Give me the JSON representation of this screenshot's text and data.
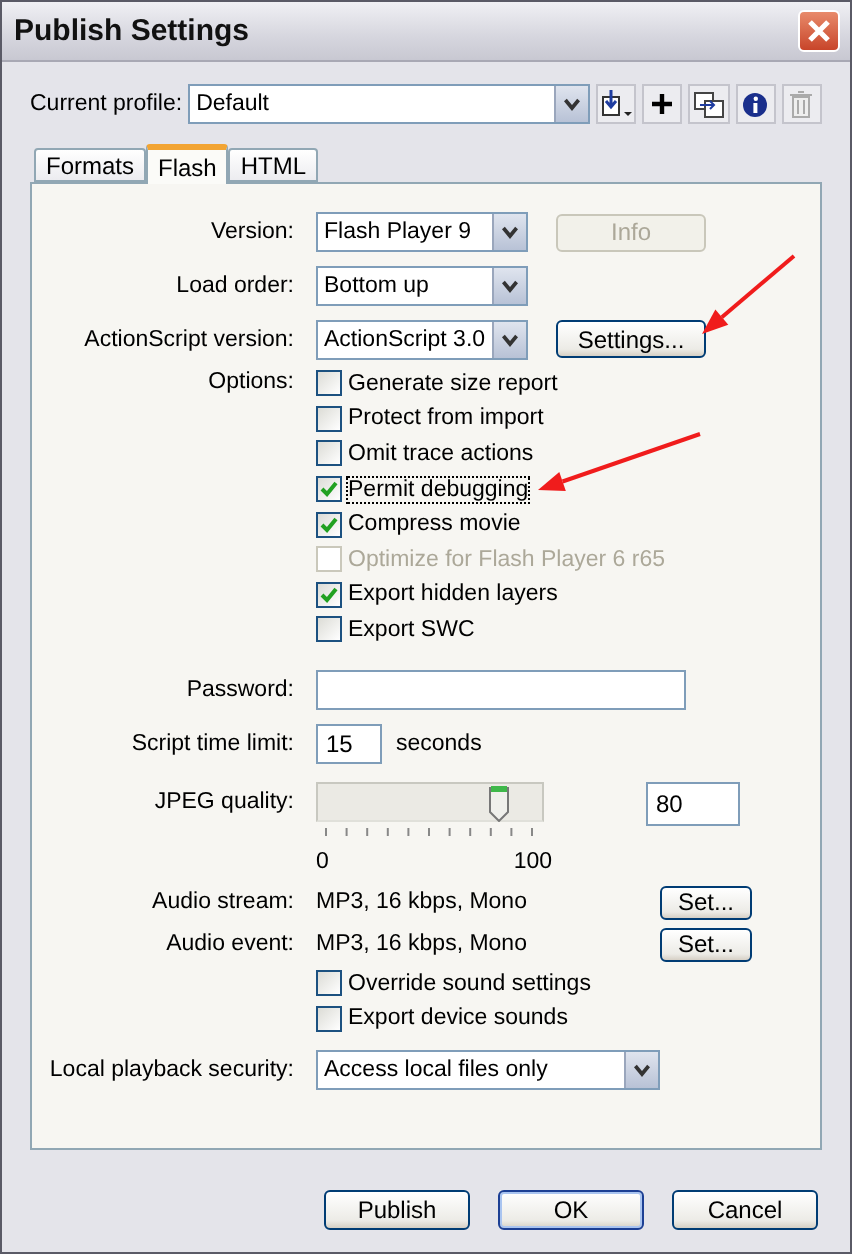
{
  "window": {
    "title": "Publish Settings"
  },
  "profile": {
    "label": "Current profile:",
    "value": "Default"
  },
  "tabs": [
    {
      "label": "Formats",
      "selected": false
    },
    {
      "label": "Flash",
      "selected": true
    },
    {
      "label": "HTML",
      "selected": false
    }
  ],
  "version": {
    "label": "Version:",
    "value": "Flash Player 9"
  },
  "info_button": {
    "label": "Info",
    "disabled": true
  },
  "load_order": {
    "label": "Load order:",
    "value": "Bottom up"
  },
  "actionscript": {
    "label": "ActionScript version:",
    "value": "ActionScript 3.0"
  },
  "settings_button": {
    "label": "Settings..."
  },
  "options": {
    "label": "Options:",
    "items": [
      {
        "label": "Generate size report",
        "checked": false,
        "disabled": false
      },
      {
        "label": "Protect from import",
        "checked": false,
        "disabled": false
      },
      {
        "label": "Omit trace actions",
        "checked": false,
        "disabled": false
      },
      {
        "label": "Permit debugging",
        "checked": true,
        "disabled": false,
        "focused": true
      },
      {
        "label": "Compress movie",
        "checked": true,
        "disabled": false
      },
      {
        "label": "Optimize for Flash Player 6 r65",
        "checked": false,
        "disabled": true
      },
      {
        "label": "Export hidden layers",
        "checked": true,
        "disabled": false
      },
      {
        "label": "Export SWC",
        "checked": false,
        "disabled": false
      }
    ]
  },
  "password": {
    "label": "Password:"
  },
  "script_time_limit": {
    "label": "Script time limit:",
    "value": "15",
    "unit": "seconds"
  },
  "jpeg_quality": {
    "label": "JPEG quality:",
    "level": 0.8,
    "value": "80",
    "min_label": "0",
    "max_label": "100"
  },
  "audio_stream": {
    "label": "Audio stream:",
    "value": "MP3, 16 kbps, Mono",
    "button": "Set..."
  },
  "audio_event": {
    "label": "Audio event:",
    "value": "MP3, 16 kbps, Mono",
    "button": "Set..."
  },
  "sound_options": [
    {
      "label": "Override sound settings",
      "checked": false
    },
    {
      "label": "Export device sounds",
      "checked": false
    }
  ],
  "local_playback": {
    "label": "Local playback security:",
    "value": "Access local files only"
  },
  "buttons": [
    {
      "label": "Publish",
      "default": false
    },
    {
      "label": "OK",
      "default": true
    },
    {
      "label": "Cancel",
      "default": false
    }
  ]
}
